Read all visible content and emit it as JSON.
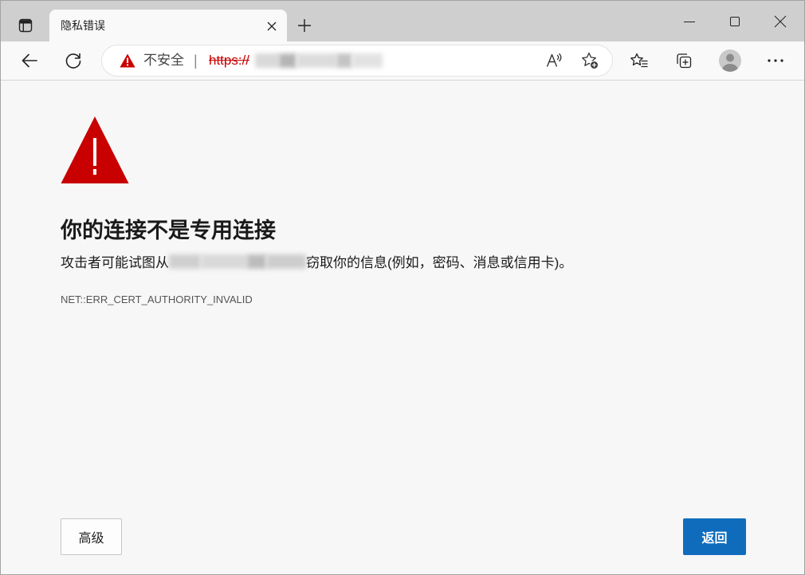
{
  "tabs": [
    {
      "title": "隐私错误"
    }
  ],
  "address_bar": {
    "security_label": "不安全",
    "separator": "|",
    "url_scheme": "https://"
  },
  "error": {
    "heading": "你的连接不是专用连接",
    "description_before": "攻击者可能试图从",
    "description_after": "窃取你的信息(例如，密码、消息或信用卡)。",
    "code": "NET::ERR_CERT_AUTHORITY_INVALID"
  },
  "buttons": {
    "advanced": "高级",
    "back": "返回"
  },
  "icons": {
    "tab_actions": "tab-actions-icon",
    "tab_close": "close-icon",
    "new_tab": "plus-icon",
    "minimize": "minimize-icon",
    "maximize": "maximize-icon",
    "close_window": "close-window-icon",
    "back": "arrow-left-icon",
    "refresh": "refresh-icon",
    "security_warning": "warning-triangle-icon",
    "read_aloud": "read-aloud-icon",
    "add_favorite": "star-add-icon",
    "favorites": "favorites-icon",
    "collections": "collections-icon",
    "profile": "profile-avatar-icon",
    "more": "more-dots-icon",
    "error_warning": "large-warning-triangle-icon"
  },
  "colors": {
    "accent": "#0f6cbd",
    "danger": "#c80000",
    "content_background": "#f7f7f7",
    "tab_strip": "#cfcfcf",
    "toolbar": "#f9f9f9"
  }
}
